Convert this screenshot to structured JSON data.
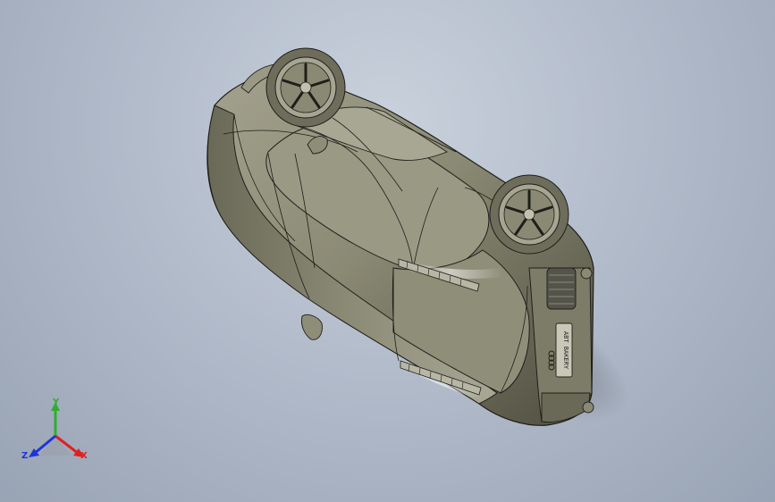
{
  "viewport": {
    "colors": {
      "bg_top": "#c9d1dc",
      "bg_bottom": "#98a3b4",
      "body": "#8e8c78",
      "edge": "#1e1e1a"
    },
    "model": {
      "icon": "car-model",
      "plate_text": "ABT BAKERY",
      "badge_icon": "four-rings-logo"
    },
    "triad": {
      "x_label": "X",
      "y_label": "Y",
      "z_label": "Z",
      "x_color": "#e02020",
      "y_color": "#2fae2f",
      "z_color": "#2034d8"
    }
  }
}
